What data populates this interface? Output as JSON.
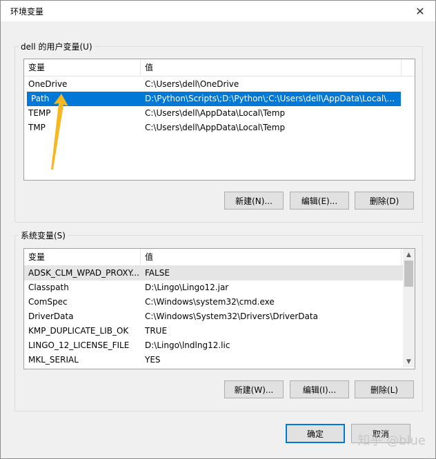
{
  "window": {
    "title": "环境变量"
  },
  "user_group": {
    "label": "dell 的用户变量(U)"
  },
  "user_vars": {
    "headers": [
      "变量",
      "值"
    ],
    "rows": [
      {
        "name": "OneDrive",
        "value": "C:\\Users\\dell\\OneDrive"
      },
      {
        "name": "Path",
        "value": "D:\\Python\\Scripts\\;D:\\Python\\;C:\\Users\\dell\\AppData\\Local\\M..."
      },
      {
        "name": "TEMP",
        "value": "C:\\Users\\dell\\AppData\\Local\\Temp"
      },
      {
        "name": "TMP",
        "value": "C:\\Users\\dell\\AppData\\Local\\Temp"
      }
    ],
    "selected_index": 1
  },
  "user_buttons": {
    "new": "新建(N)...",
    "edit": "编辑(E)...",
    "delete": "删除(D)"
  },
  "sys_group": {
    "label": "系统变量(S)"
  },
  "sys_vars": {
    "headers": [
      "变量",
      "值"
    ],
    "rows": [
      {
        "name": "ADSK_CLM_WPAD_PROXY...",
        "value": "FALSE"
      },
      {
        "name": "Classpath",
        "value": "D:\\Lingo\\Lingo12.jar"
      },
      {
        "name": "ComSpec",
        "value": "C:\\Windows\\system32\\cmd.exe"
      },
      {
        "name": "DriverData",
        "value": "C:\\Windows\\System32\\Drivers\\DriverData"
      },
      {
        "name": "KMP_DUPLICATE_LIB_OK",
        "value": "TRUE"
      },
      {
        "name": "LINGO_12_LICENSE_FILE",
        "value": "D:\\Lingo\\lndlng12.lic"
      },
      {
        "name": "MKL_SERIAL",
        "value": "YES"
      }
    ],
    "highlighted_index": 0
  },
  "sys_buttons": {
    "new": "新建(W)...",
    "edit": "编辑(I)...",
    "delete": "删除(L)"
  },
  "footer": {
    "ok": "确定",
    "cancel": "取消"
  },
  "watermark": "知乎 @blue",
  "colors": {
    "selection": "#0078d7",
    "arrow": "#f5b820"
  },
  "icons": {
    "close": "close-icon",
    "scroll_up": "chevron-up-icon",
    "scroll_down": "chevron-down-icon"
  }
}
